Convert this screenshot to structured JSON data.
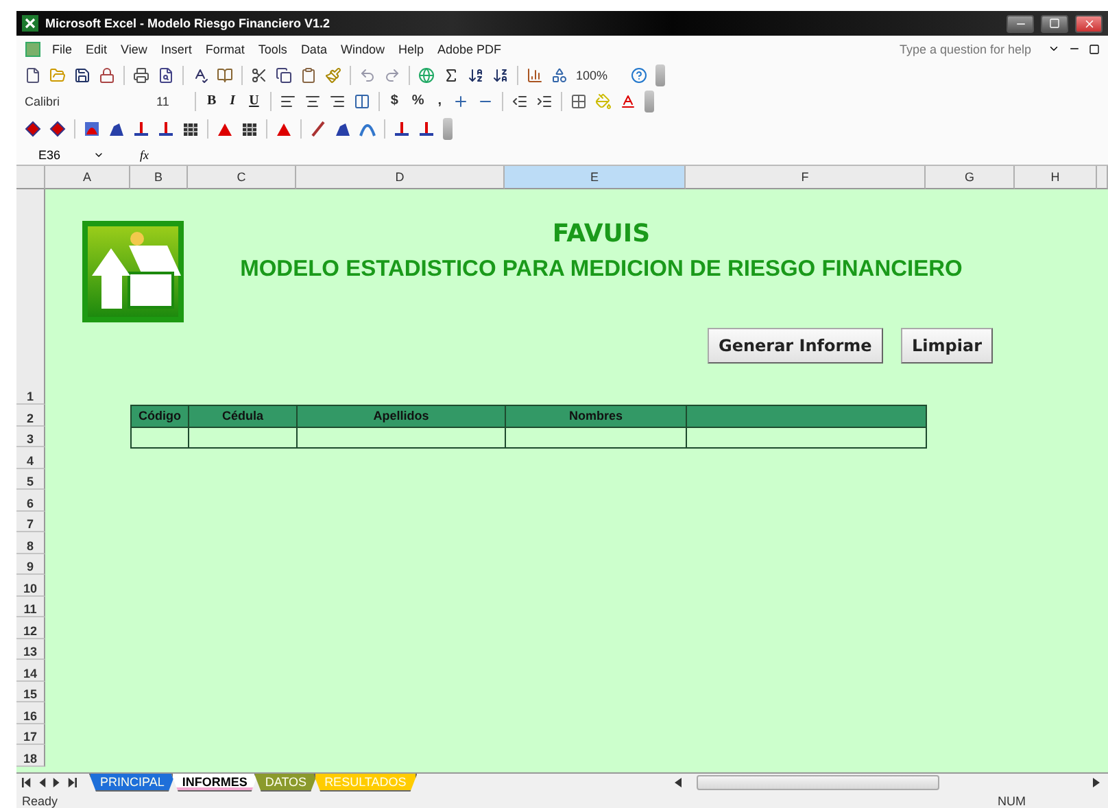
{
  "window": {
    "title": "Microsoft Excel - Modelo Riesgo Financiero V1.2"
  },
  "menu": [
    "File",
    "Edit",
    "View",
    "Insert",
    "Format",
    "Tools",
    "Data",
    "Window",
    "Help",
    "Adobe PDF"
  ],
  "help_search": {
    "placeholder": "Type a question for help"
  },
  "standard_toolbar": {
    "zoom": "100%"
  },
  "formatting_toolbar": {
    "font": "Calibri",
    "size": "11",
    "styles": [
      "B",
      "I",
      "U"
    ],
    "number_formats": [
      "$",
      "%",
      ","
    ]
  },
  "name_box": "E36",
  "formula_label": "fx",
  "columns": [
    {
      "label": "A",
      "selected": false
    },
    {
      "label": "B",
      "selected": false
    },
    {
      "label": "C",
      "selected": false
    },
    {
      "label": "D",
      "selected": false
    },
    {
      "label": "E",
      "selected": true
    },
    {
      "label": "F",
      "selected": false
    },
    {
      "label": "G",
      "selected": false
    },
    {
      "label": "H",
      "selected": false
    }
  ],
  "rows": [
    "1",
    "2",
    "3",
    "4",
    "5",
    "6",
    "7",
    "8",
    "9",
    "10",
    "11",
    "12",
    "13",
    "14",
    "15",
    "16",
    "17",
    "18"
  ],
  "sheet": {
    "brand": "FAVUIS",
    "title": "MODELO ESTADISTICO PARA MEDICION DE RIESGO FINANCIERO",
    "buttons": [
      "Generar Informe",
      "Limpiar"
    ],
    "table": {
      "columns": [
        "Código",
        "Cédula",
        "Apellidos",
        "Nombres"
      ]
    }
  },
  "sheet_tabs": [
    {
      "label": "PRINCIPAL",
      "color": "#1e6fd9",
      "selected": false
    },
    {
      "label": "INFORMES",
      "color": "#f4a6cf",
      "selected": true
    },
    {
      "label": "DATOS",
      "color": "#8b9a2c",
      "selected": false
    },
    {
      "label": "RESULTADOS",
      "color": "#ffcc00",
      "selected": false
    }
  ],
  "status_bar": {
    "left": "Ready",
    "right": "NUM"
  }
}
